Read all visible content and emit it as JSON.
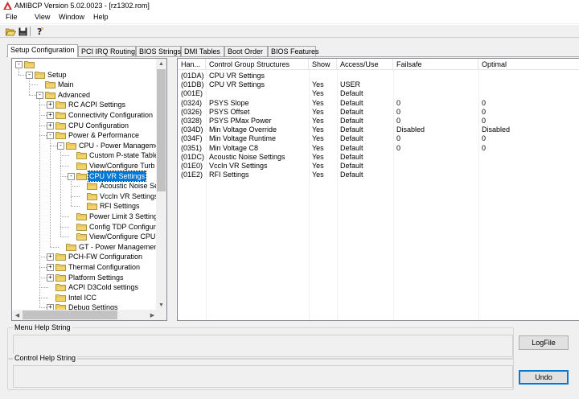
{
  "window": {
    "title": "AMIBCP Version 5.02.0023 - [rz1302.rom]"
  },
  "menu": {
    "file": "File",
    "view": "View",
    "window": "Window",
    "help": "Help"
  },
  "tabs": [
    "Setup Configuration",
    "PCI IRQ Routing",
    "BIOS Strings",
    "DMI Tables",
    "Boot Order",
    "BIOS Features"
  ],
  "tree": [
    {
      "label": "",
      "level": 0,
      "toggle": "-"
    },
    {
      "label": "Setup",
      "level": 1,
      "toggle": "-"
    },
    {
      "label": "Main",
      "level": 2,
      "toggle": ""
    },
    {
      "label": "Advanced",
      "level": 2,
      "toggle": "-"
    },
    {
      "label": "RC ACPI Settings",
      "level": 3,
      "toggle": "+"
    },
    {
      "label": "Connectivity Configuration",
      "level": 3,
      "toggle": "+"
    },
    {
      "label": "CPU Configuration",
      "level": 3,
      "toggle": "+"
    },
    {
      "label": "Power & Performance",
      "level": 3,
      "toggle": "-"
    },
    {
      "label": "CPU - Power Manageme",
      "level": 4,
      "toggle": "-"
    },
    {
      "label": "Custom P-state Table",
      "level": 5,
      "toggle": ""
    },
    {
      "label": "View/Configure Turb",
      "level": 5,
      "toggle": ""
    },
    {
      "label": "CPU VR Settings",
      "level": 5,
      "toggle": "-",
      "selected": true
    },
    {
      "label": "Acoustic Noise Set",
      "level": 6,
      "toggle": ""
    },
    {
      "label": "VccIn VR Settings",
      "level": 6,
      "toggle": ""
    },
    {
      "label": "RFI Settings",
      "level": 6,
      "toggle": ""
    },
    {
      "label": "Power Limit 3 Settings",
      "level": 5,
      "toggle": ""
    },
    {
      "label": "Config TDP Configur",
      "level": 5,
      "toggle": ""
    },
    {
      "label": "View/Configure CPU",
      "level": 5,
      "toggle": ""
    },
    {
      "label": "GT - Power Management",
      "level": 4,
      "toggle": ""
    },
    {
      "label": "PCH-FW Configuration",
      "level": 3,
      "toggle": "+"
    },
    {
      "label": "Thermal Configuration",
      "level": 3,
      "toggle": "+"
    },
    {
      "label": "Platform Settings",
      "level": 3,
      "toggle": "+"
    },
    {
      "label": "ACPI D3Cold settings",
      "level": 3,
      "toggle": ""
    },
    {
      "label": "Intel ICC",
      "level": 3,
      "toggle": ""
    },
    {
      "label": "Debug Settings",
      "level": 3,
      "toggle": "+"
    }
  ],
  "table": {
    "headers": [
      "Han...",
      "Control Group Structures",
      "Show",
      "Access/Use",
      "Failsafe",
      "Optimal"
    ],
    "rows": [
      [
        "(01DA)",
        "CPU VR Settings",
        "",
        "",
        "",
        ""
      ],
      [
        "(01DB)",
        "CPU VR Settings",
        "Yes",
        "USER",
        "",
        ""
      ],
      [
        "(001E)",
        "",
        "Yes",
        "Default",
        "",
        ""
      ],
      [
        "(0324)",
        "PSYS Slope",
        "Yes",
        "Default",
        "0",
        "0"
      ],
      [
        "(0326)",
        "PSYS Offset",
        "Yes",
        "Default",
        "0",
        "0"
      ],
      [
        "(0328)",
        "PSYS PMax Power",
        "Yes",
        "Default",
        "0",
        "0"
      ],
      [
        "(034D)",
        "Min Voltage Override",
        "Yes",
        "Default",
        "Disabled",
        "Disabled"
      ],
      [
        "(034F)",
        "Min Voltage Runtime",
        "Yes",
        "Default",
        "0",
        "0"
      ],
      [
        "(0351)",
        "Min Voltage C8",
        "Yes",
        "Default",
        "0",
        "0"
      ],
      [
        "(01DC)",
        "Acoustic Noise Settings",
        "Yes",
        "Default",
        "",
        ""
      ],
      [
        "(01E0)",
        "VccIn VR Settings",
        "Yes",
        "Default",
        "",
        ""
      ],
      [
        "(01E2)",
        "RFI Settings",
        "Yes",
        "Default",
        "",
        ""
      ]
    ]
  },
  "menu_help": {
    "title": "Menu Help String"
  },
  "control_help": {
    "title": "Control Help String"
  },
  "buttons": {
    "logfile": "LogFile",
    "undo": "Undo"
  },
  "colors": {
    "selection": "#0078d7",
    "folder": "#f2d46b",
    "title_icon": "#d4262c"
  }
}
